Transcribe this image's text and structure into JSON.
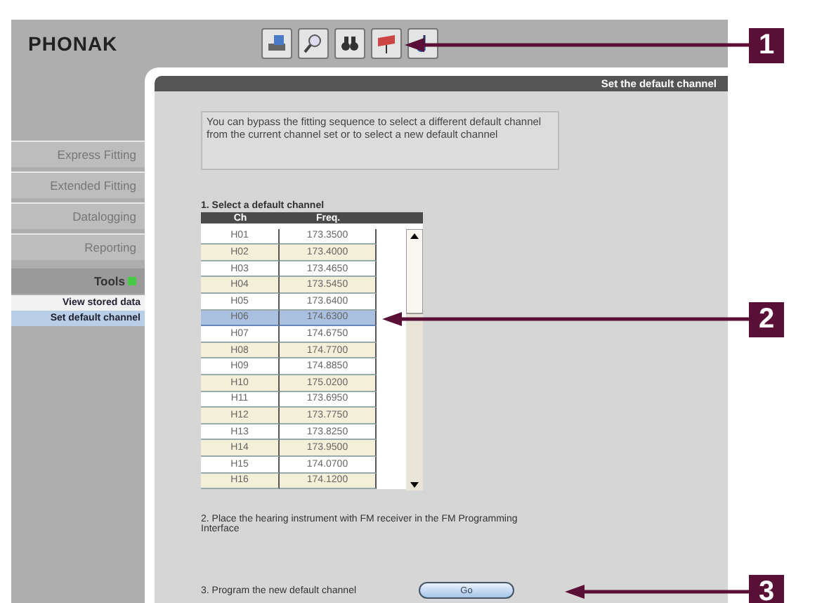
{
  "logo": "PHONAK",
  "toolbar": [
    {
      "kind": "device"
    },
    {
      "kind": "magnifier"
    },
    {
      "kind": "binoculars"
    },
    {
      "kind": "flag"
    },
    {
      "kind": "music"
    }
  ],
  "panel_title": "Set the default channel",
  "sidebar": {
    "items": [
      {
        "label": "Express Fitting",
        "kind": "tab"
      },
      {
        "label": "Extended Fitting",
        "kind": "tab"
      },
      {
        "label": "Datalogging",
        "kind": "tab"
      },
      {
        "label": "Reporting",
        "kind": "tab"
      },
      {
        "label": "Tools",
        "kind": "section"
      },
      {
        "label": "View stored data",
        "kind": "sub",
        "selected": false
      },
      {
        "label": "Set default channel",
        "kind": "sub",
        "selected": true
      }
    ]
  },
  "intro": "You can bypass the fitting sequence to select a different default channel from the current channel set or to select a new default channel",
  "step1": "1. Select a default channel",
  "table": {
    "columns": [
      "Ch",
      "Freq."
    ],
    "rows": [
      {
        "ch": "H01",
        "freq": "173.3500",
        "selected": false
      },
      {
        "ch": "H02",
        "freq": "173.4000",
        "selected": false
      },
      {
        "ch": "H03",
        "freq": "173.4650",
        "selected": false
      },
      {
        "ch": "H04",
        "freq": "173.5450",
        "selected": false
      },
      {
        "ch": "H05",
        "freq": "173.6400",
        "selected": false
      },
      {
        "ch": "H06",
        "freq": "174.6300",
        "selected": true
      },
      {
        "ch": "H07",
        "freq": "174.6750",
        "selected": false
      },
      {
        "ch": "H08",
        "freq": "174.7700",
        "selected": false
      },
      {
        "ch": "H09",
        "freq": "174.8850",
        "selected": false
      },
      {
        "ch": "H10",
        "freq": "175.0200",
        "selected": false
      },
      {
        "ch": "H11",
        "freq": "173.6950",
        "selected": false
      },
      {
        "ch": "H12",
        "freq": "173.7750",
        "selected": false
      },
      {
        "ch": "H13",
        "freq": "173.8250",
        "selected": false
      },
      {
        "ch": "H14",
        "freq": "173.9500",
        "selected": false
      },
      {
        "ch": "H15",
        "freq": "174.0700",
        "selected": false
      },
      {
        "ch": "H16",
        "freq": "174.1200",
        "selected": false
      }
    ]
  },
  "step2": "2. Place the hearing instrument with FM receiver in the FM Programming Interface",
  "step3": "3. Program the new default channel",
  "go_button": "Go",
  "callouts": [
    {
      "label": "1"
    },
    {
      "label": "2"
    },
    {
      "label": "3"
    }
  ]
}
